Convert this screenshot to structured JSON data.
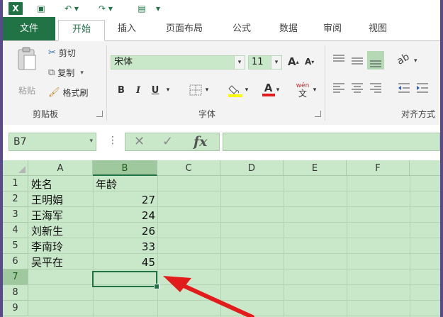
{
  "quick_access": {
    "logo": "X",
    "save_icon": "▣",
    "undo_icon": "↶ ▾",
    "redo_icon": "↷ ▾",
    "customize_icon": "▤",
    "more_icon": "▾"
  },
  "tabs": {
    "file": "文件",
    "home": "开始",
    "insert": "插入",
    "layout": "页面布局",
    "formula": "公式",
    "data": "数据",
    "review": "审阅",
    "view": "视图"
  },
  "ribbon": {
    "clipboard": {
      "paste": "粘贴",
      "cut": "剪切",
      "copy": "复制",
      "format_painter": "格式刷",
      "group_label": "剪贴板"
    },
    "font": {
      "font_name": "宋体",
      "font_size": "11",
      "grow_icon": "A",
      "shrink_icon": "A",
      "bold": "B",
      "italic": "I",
      "underline": "U",
      "wen_top": "wén",
      "wen_bottom": "文",
      "group_label": "字体"
    },
    "alignment": {
      "group_label": "对齐方式"
    }
  },
  "formula_bar": {
    "name_box": "B7",
    "cancel_icon": "✕",
    "enter_icon": "✓",
    "fx": "fx",
    "formula": ""
  },
  "grid": {
    "columns": [
      "A",
      "B",
      "C",
      "D",
      "E",
      "F"
    ],
    "rows": [
      "1",
      "2",
      "3",
      "4",
      "5",
      "6",
      "7",
      "8",
      "9"
    ],
    "cells": {
      "A1": "姓名",
      "B1": "年龄",
      "A2": "王明娟",
      "B2": "27",
      "A3": "王海军",
      "B3": "24",
      "A4": "刘新生",
      "B4": "26",
      "A5": "李南玲",
      "B5": "33",
      "A6": "吴平在",
      "B6": "45"
    },
    "selected_cell": "B7"
  },
  "colors": {
    "excel_green": "#217346",
    "cell_fill": "#c9e8c9",
    "arrow_red": "#e21b1b"
  }
}
